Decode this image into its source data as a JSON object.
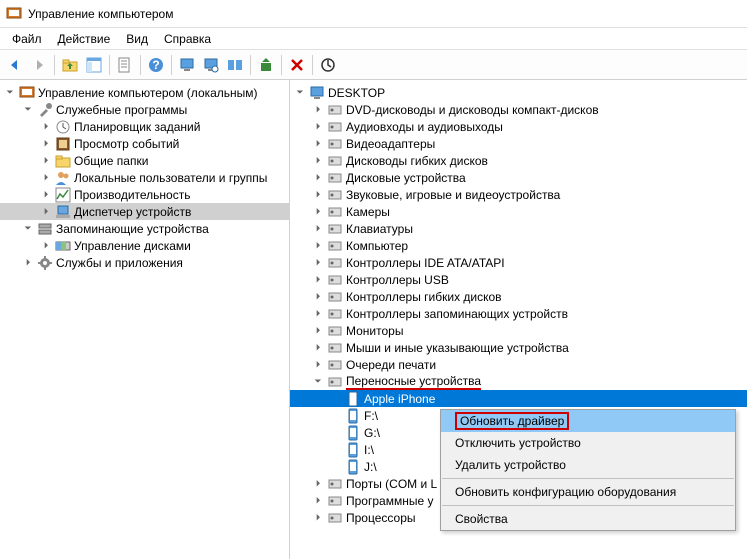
{
  "window": {
    "title": "Управление компьютером"
  },
  "menu": {
    "file": "Файл",
    "action": "Действие",
    "view": "Вид",
    "help": "Справка"
  },
  "toolbar_icons": [
    "back",
    "forward",
    "up",
    "console",
    "props",
    "help",
    "dm1",
    "dm2",
    "dm3",
    "dm4",
    "delete",
    "scan"
  ],
  "left_tree": {
    "root": "Управление компьютером (локальным)",
    "nodes": [
      {
        "label": "Служебные программы",
        "expanded": true,
        "children": [
          {
            "label": "Планировщик заданий"
          },
          {
            "label": "Просмотр событий"
          },
          {
            "label": "Общие папки"
          },
          {
            "label": "Локальные пользователи и группы"
          },
          {
            "label": "Производительность"
          },
          {
            "label": "Диспетчер устройств",
            "selected": true
          }
        ]
      },
      {
        "label": "Запоминающие устройства",
        "expanded": true,
        "children": [
          {
            "label": "Управление дисками"
          }
        ]
      },
      {
        "label": "Службы и приложения",
        "expanded": false
      }
    ]
  },
  "right_tree": {
    "root": "DESKTOP",
    "categories": [
      {
        "label": "DVD-дисководы и дисководы компакт-дисков"
      },
      {
        "label": "Аудиовходы и аудиовыходы"
      },
      {
        "label": "Видеоадаптеры"
      },
      {
        "label": "Дисководы гибких дисков"
      },
      {
        "label": "Дисковые устройства"
      },
      {
        "label": "Звуковые, игровые и видеоустройства"
      },
      {
        "label": "Камеры"
      },
      {
        "label": "Клавиатуры"
      },
      {
        "label": "Компьютер"
      },
      {
        "label": "Контроллеры IDE ATA/ATAPI"
      },
      {
        "label": "Контроллеры USB"
      },
      {
        "label": "Контроллеры гибких дисков"
      },
      {
        "label": "Контроллеры запоминающих устройств"
      },
      {
        "label": "Мониторы"
      },
      {
        "label": "Мыши и иные указывающие устройства"
      },
      {
        "label": "Очереди печати"
      },
      {
        "label": "Переносные устройства",
        "expanded": true,
        "highlight": true,
        "children": [
          {
            "label": "Apple iPhone",
            "selected": true
          },
          {
            "label": "F:\\"
          },
          {
            "label": "G:\\"
          },
          {
            "label": "I:\\"
          },
          {
            "label": "J:\\"
          }
        ]
      },
      {
        "label": "Порты (COM и L"
      },
      {
        "label": "Программные у"
      },
      {
        "label": "Процессоры"
      }
    ]
  },
  "context_menu": {
    "items": [
      {
        "label": "Обновить драйвер",
        "highlight": true,
        "boxed": true
      },
      {
        "label": "Отключить устройство"
      },
      {
        "label": "Удалить устройство"
      },
      {
        "sep": true
      },
      {
        "label": "Обновить конфигурацию оборудования"
      },
      {
        "sep": true
      },
      {
        "label": "Свойства"
      }
    ]
  }
}
